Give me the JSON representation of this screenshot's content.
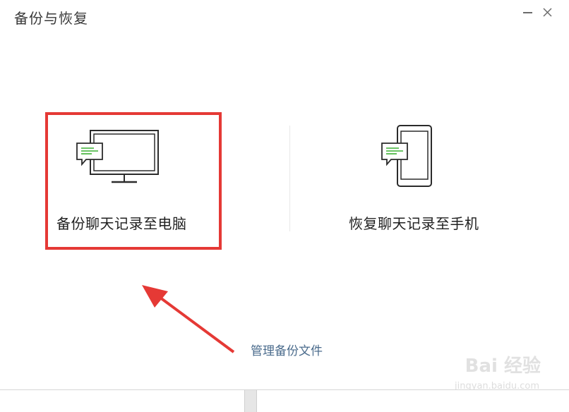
{
  "window": {
    "title": "备份与恢复"
  },
  "options": {
    "backup": {
      "label": "备份聊天记录至电脑",
      "icon": "computer-chat-icon"
    },
    "restore": {
      "label": "恢复聊天记录至手机",
      "icon": "phone-chat-icon"
    }
  },
  "links": {
    "manage": "管理备份文件"
  },
  "watermark": {
    "main": "Bai 经验",
    "sub": "jingyan.baidu.com"
  },
  "colors": {
    "highlight": "#e53935",
    "arrow": "#e53935",
    "link": "#4a6b8c",
    "chat_green": "#3cb034"
  }
}
